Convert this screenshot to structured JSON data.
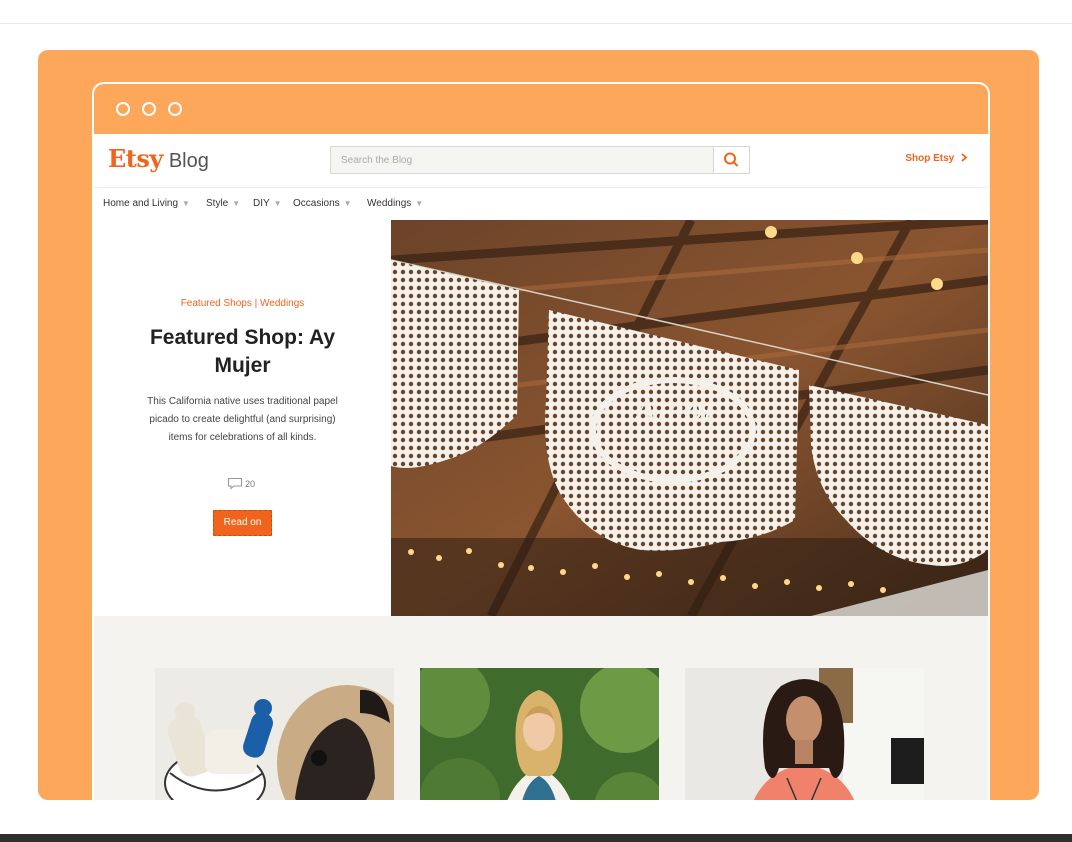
{
  "blog": {
    "logo_brand": "Etsy",
    "logo_suffix": "Blog",
    "search_placeholder": "Search the Blog",
    "shop_link": "Shop Etsy",
    "shop_link_icon": "chevron-right-icon"
  },
  "nav": {
    "items": [
      {
        "label": "Home and Living"
      },
      {
        "label": "Style"
      },
      {
        "label": "DIY"
      },
      {
        "label": "Occasions"
      },
      {
        "label": "Weddings"
      }
    ]
  },
  "feature": {
    "category": "Featured Shops | Weddings",
    "title": "Featured Shop: Ay Mujer",
    "description": "This California native uses traditional papel picado to create delightful (and surprising) items for celebrations of all kinds.",
    "comment_count": "20",
    "comment_icon": "comment-icon",
    "button_label": "Read on",
    "image_text": "Amor"
  },
  "colors": {
    "panel": "#fda75a",
    "accent": "#f1641e",
    "background": "#f4f3ef"
  }
}
